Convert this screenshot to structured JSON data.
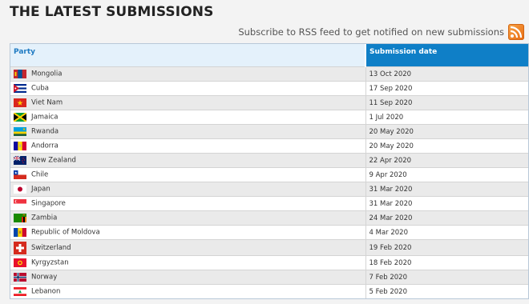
{
  "title": "THE LATEST SUBMISSIONS",
  "rss": {
    "text": "Subscribe to RSS feed to get notified on new submissions"
  },
  "table": {
    "headers": {
      "party": "Party",
      "date": "Submission date"
    },
    "rows": [
      {
        "party": "Mongolia",
        "date": "13 Oct 2020",
        "flag": "mongolia-flag-icon"
      },
      {
        "party": "Cuba",
        "date": "17 Sep 2020",
        "flag": "cuba-flag-icon"
      },
      {
        "party": "Viet Nam",
        "date": "11 Sep 2020",
        "flag": "viet-nam-flag-icon"
      },
      {
        "party": "Jamaica",
        "date": "1 Jul 2020",
        "flag": "jamaica-flag-icon"
      },
      {
        "party": "Rwanda",
        "date": "20 May 2020",
        "flag": "rwanda-flag-icon"
      },
      {
        "party": "Andorra",
        "date": "20 May 2020",
        "flag": "andorra-flag-icon"
      },
      {
        "party": "New Zealand",
        "date": "22 Apr 2020",
        "flag": "new-zealand-flag-icon"
      },
      {
        "party": "Chile",
        "date": "9 Apr 2020",
        "flag": "chile-flag-icon"
      },
      {
        "party": "Japan",
        "date": "31 Mar 2020",
        "flag": "japan-flag-icon"
      },
      {
        "party": "Singapore",
        "date": "31 Mar 2020",
        "flag": "singapore-flag-icon"
      },
      {
        "party": "Zambia",
        "date": "24 Mar 2020",
        "flag": "zambia-flag-icon"
      },
      {
        "party": "Republic of Moldova",
        "date": "4 Mar 2020",
        "flag": "moldova-flag-icon"
      },
      {
        "party": "Switzerland",
        "date": "19 Feb 2020",
        "flag": "switzerland-flag-icon"
      },
      {
        "party": "Kyrgyzstan",
        "date": "18 Feb 2020",
        "flag": "kyrgyzstan-flag-icon"
      },
      {
        "party": "Norway",
        "date": "7 Feb 2020",
        "flag": "norway-flag-icon"
      },
      {
        "party": "Lebanon",
        "date": "5 Feb 2020",
        "flag": "lebanon-flag-icon"
      }
    ]
  },
  "colors": {
    "header_blue": "#0f7fc7",
    "header_light": "#e4f1fb",
    "rss_orange": "#e86a10"
  }
}
